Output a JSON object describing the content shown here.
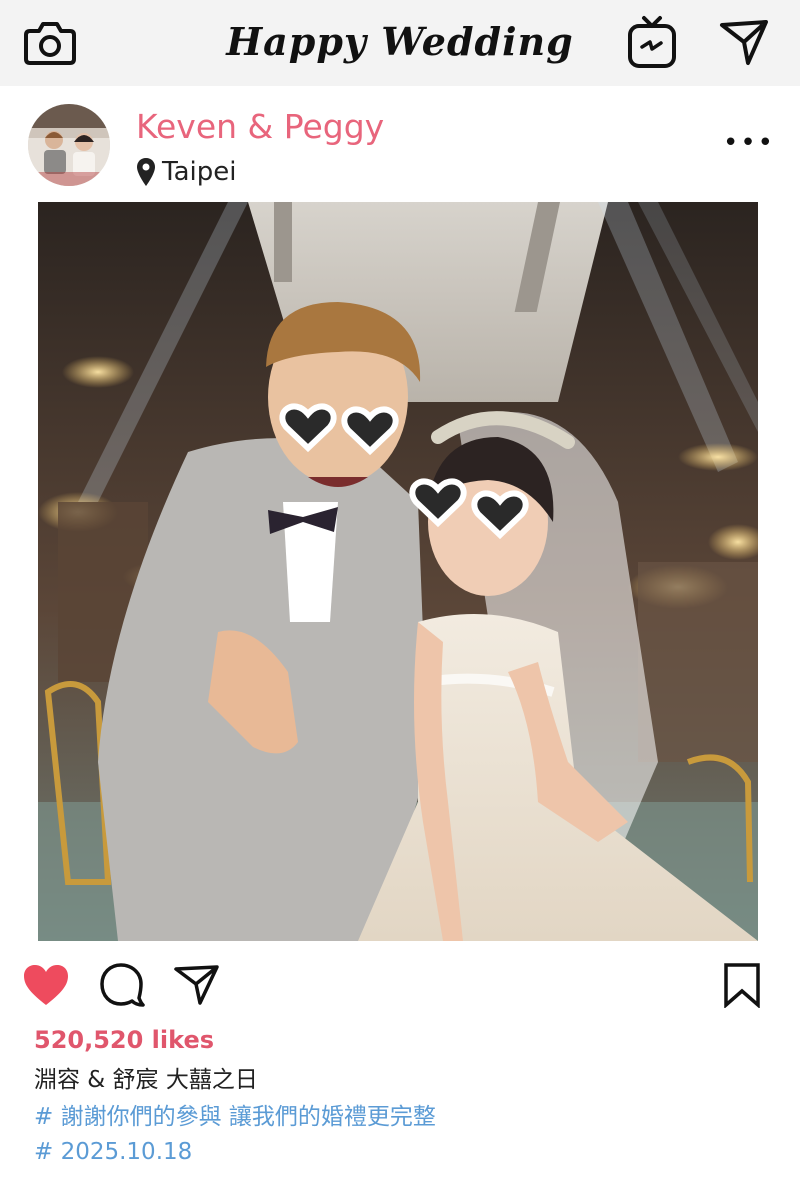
{
  "header": {
    "title": "Happy Wedding",
    "camera_icon": "camera-icon",
    "igtv_icon": "tv-icon",
    "direct_icon": "send-icon"
  },
  "post": {
    "username": "Keven & Peggy",
    "location": "Taipei",
    "more_label": "•••",
    "photo_description": "wedding couple in heart-shaped sunglasses"
  },
  "actions": {
    "like_icon": "heart-icon",
    "comment_icon": "comment-icon",
    "share_icon": "send-icon",
    "save_icon": "bookmark-icon"
  },
  "likes": "520,520 likes",
  "caption": {
    "line1": "淵容 & 舒宸 大囍之日",
    "line2": "# 謝謝你們的參與 讓我們的婚禮更完整",
    "line3": "# 2025.10.18"
  },
  "colors": {
    "accent_pink": "#e8657c",
    "like_red": "#ee4b5e",
    "hashtag_blue": "#5b9bd5",
    "topbar_bg": "#f3f3f3"
  }
}
